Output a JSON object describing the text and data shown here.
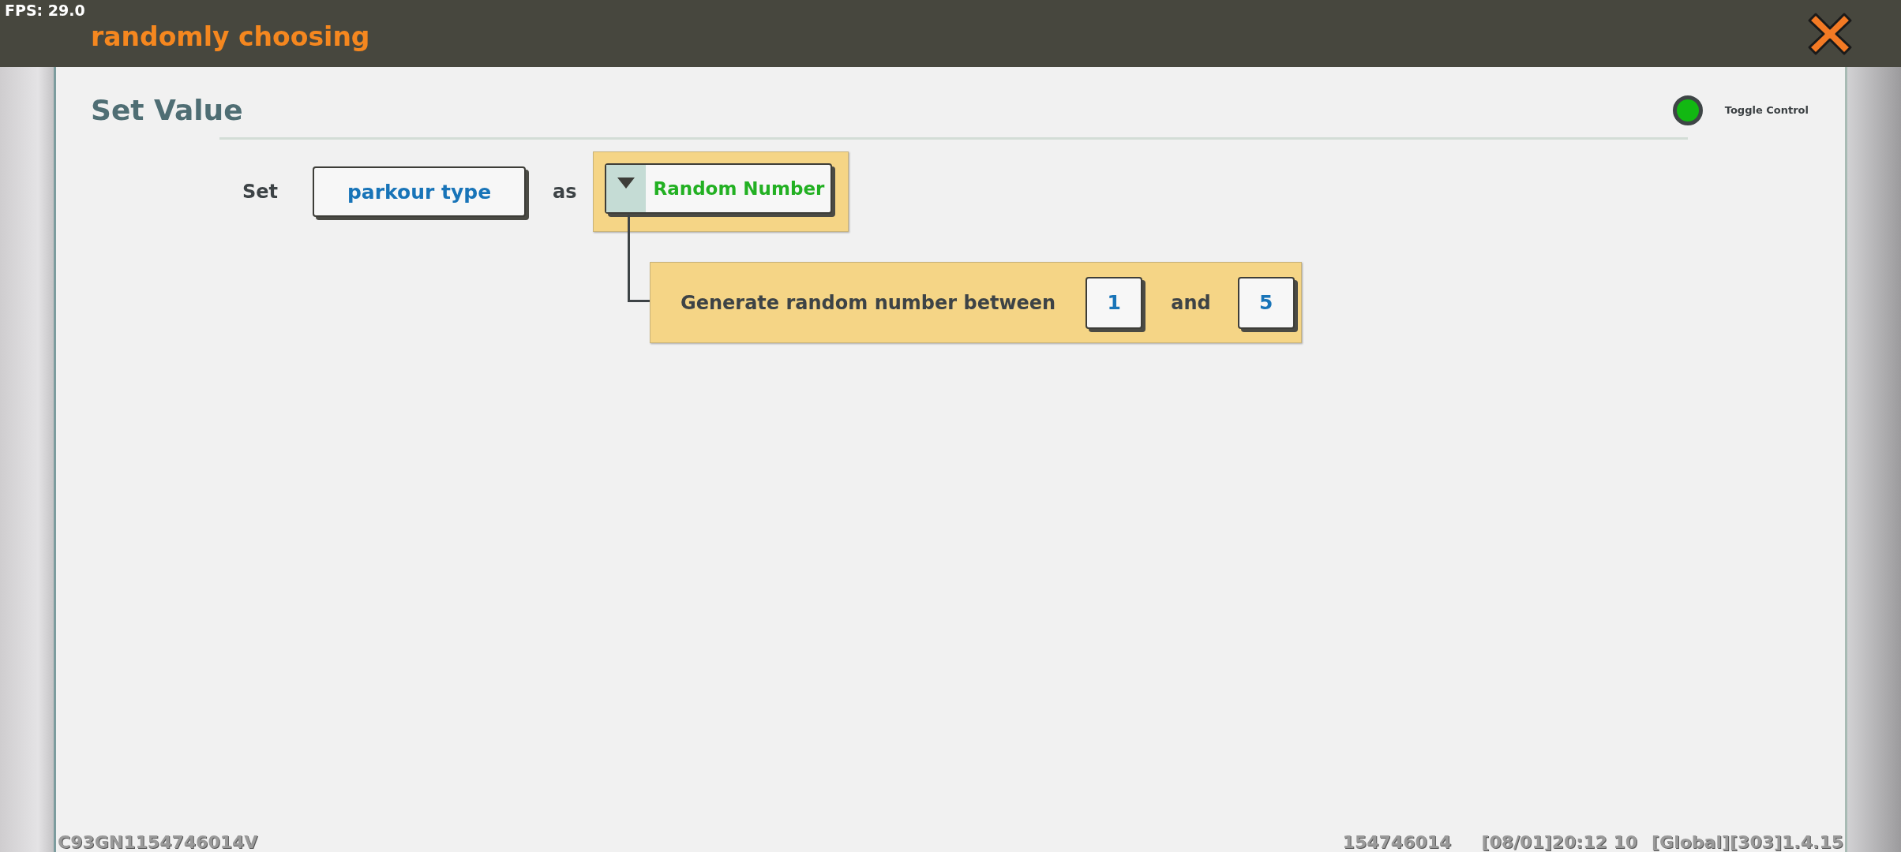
{
  "fps": "FPS: 29.0",
  "window": {
    "title": "randomly choosing"
  },
  "panel": {
    "title": "Set Value",
    "toggle": {
      "label": "Toggle Control",
      "on": true
    }
  },
  "statement": {
    "set_label": "Set",
    "variable": "parkour type",
    "as_label": "as",
    "value_type": {
      "label": "Random Number"
    },
    "generator": {
      "label": "Generate random number between",
      "min": "1",
      "and_label": "and",
      "max": "5"
    }
  },
  "status_bar": {
    "device_id": "C93GN1154746014V",
    "user_id": "154746014",
    "timestamp": "[08/01]20:12 10",
    "version": "[Global][303]1.4.15"
  }
}
